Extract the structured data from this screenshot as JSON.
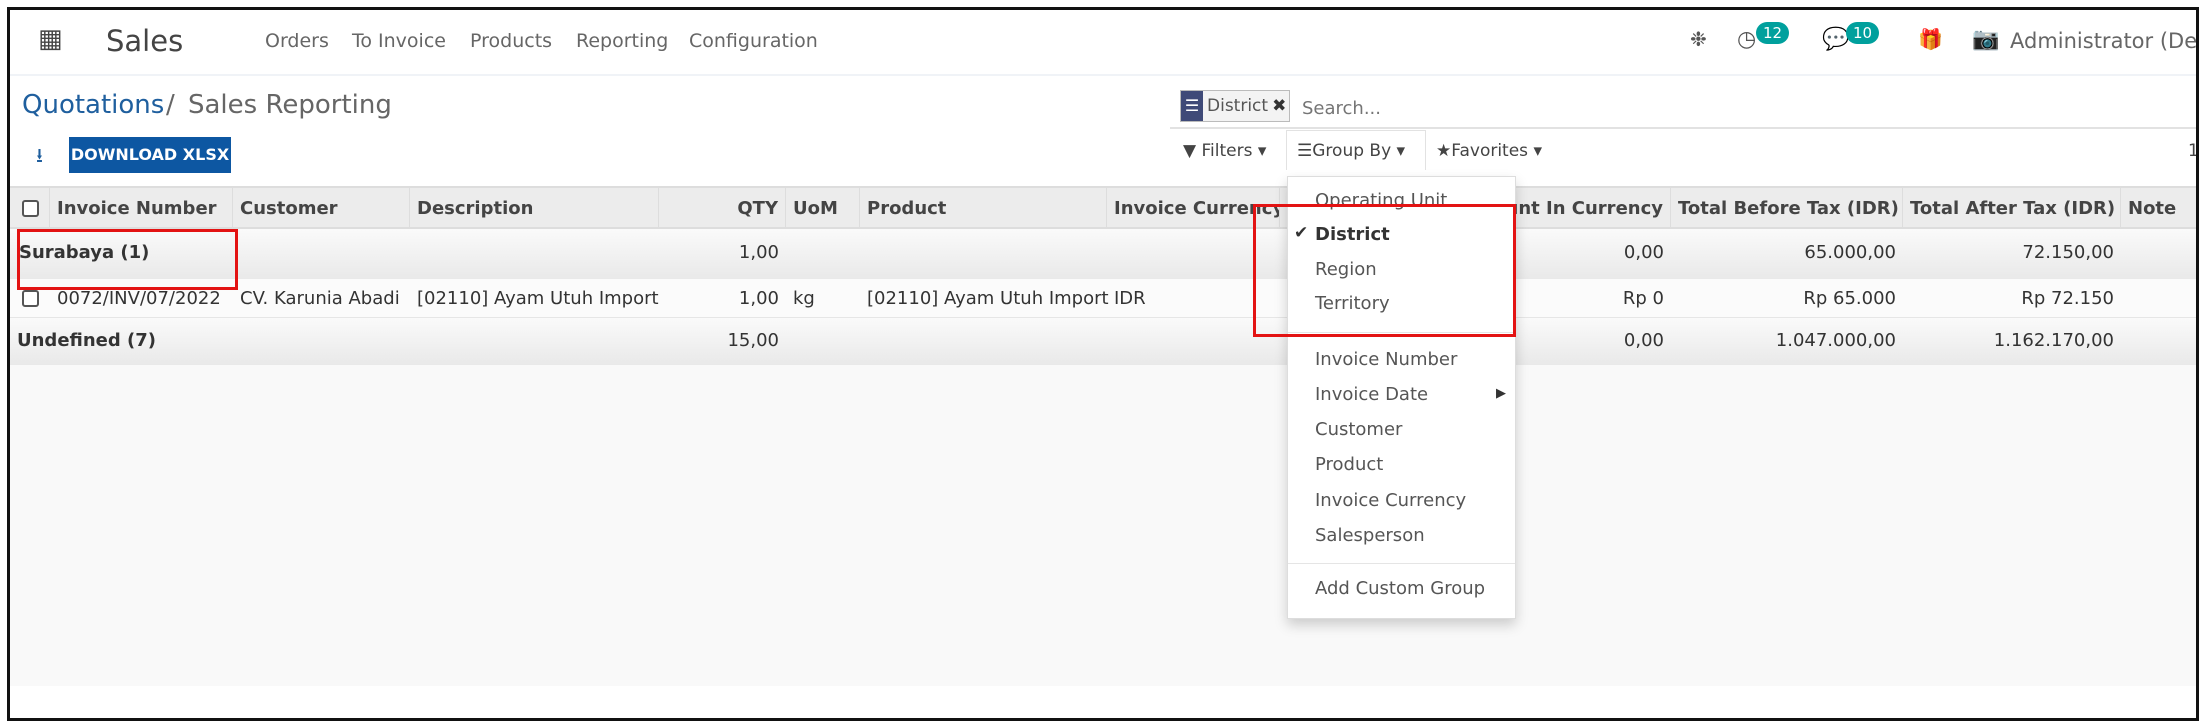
{
  "navbar": {
    "app_name": "Sales",
    "menu": [
      "Orders",
      "To Invoice",
      "Products",
      "Reporting",
      "Configuration"
    ],
    "activity_count": "12",
    "messages_count": "10",
    "user": "Administrator (Dem",
    "icons": [
      "apps-grid-icon",
      "bug-icon",
      "clock-icon",
      "chat-icon",
      "gift-icon",
      "camera-icon"
    ]
  },
  "breadcrumb": {
    "parent": "Quotations",
    "separator": "/",
    "current": "Sales Reporting"
  },
  "actions": {
    "download_label": "DOWNLOAD XLSX"
  },
  "search": {
    "facet": "District",
    "placeholder": "Search..."
  },
  "toolbar": {
    "filters": "Filters",
    "group_by": "Group By",
    "favorites": "Favorites",
    "pager": "1"
  },
  "table": {
    "headers": [
      "Invoice Number",
      "Customer",
      "Description",
      "QTY",
      "UoM",
      "Product",
      "Invoice Currency",
      "Amount In Currency",
      "Total Before Tax (IDR)",
      "Total After Tax (IDR)",
      "Note"
    ],
    "groups": [
      {
        "label": "Surabaya (1)",
        "qty": "1,00",
        "amount": "0,00",
        "before": "65.000,00",
        "after": "72.150,00",
        "rows": [
          {
            "invoice": "0072/INV/07/2022",
            "customer": "CV. Karunia Abadi",
            "description": "[02110] Ayam Utuh Import",
            "qty": "1,00",
            "uom": "kg",
            "product": "[02110] Ayam Utuh Import",
            "currency": "IDR",
            "amount": "Rp 0",
            "before": "Rp 65.000",
            "after": "Rp 72.150"
          }
        ]
      },
      {
        "label": "Undefined (7)",
        "qty": "15,00",
        "amount": "0,00",
        "before": "1.047.000,00",
        "after": "1.162.170,00"
      }
    ]
  },
  "group_by_menu": {
    "items": [
      "Operating Unit",
      "District",
      "Region",
      "Territory"
    ],
    "selected": "District",
    "fields": [
      "Invoice Number",
      "Invoice Date",
      "Customer",
      "Product",
      "Invoice Currency",
      "Salesperson"
    ],
    "custom": "Add Custom Group"
  },
  "colors": {
    "accent": "#0d57a2",
    "badge": "#00a09d",
    "highlight": "#e31313",
    "facet": "#3f4a78"
  }
}
